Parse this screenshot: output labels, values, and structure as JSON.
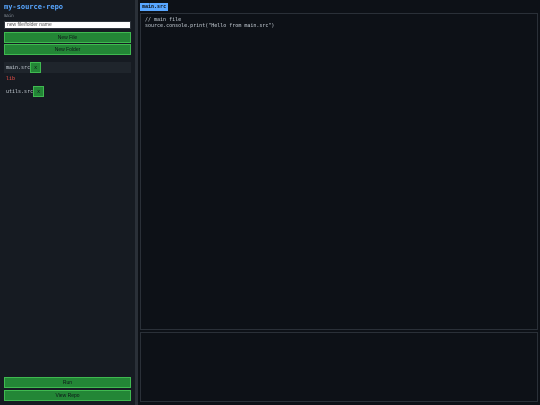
{
  "sidebar": {
    "repo_title": "my-source-repo",
    "branch": "main",
    "input_placeholder": "new file/folder name",
    "new_file_label": "New File",
    "new_folder_label": "New Folder",
    "files": [
      {
        "name": "main.src",
        "delete_label": "x"
      },
      {
        "name": "lib"
      },
      {
        "name": "utils.src",
        "delete_label": "x"
      }
    ],
    "run_label": "Run",
    "view_repo_label": "View Repo"
  },
  "editor": {
    "active_tab": "main.src",
    "lines": [
      "// main file",
      "source.console.print(\"Hello from main.src\")"
    ]
  },
  "colors": {
    "accent": "#58a6ff",
    "button": "#238636",
    "folder": "#f85149",
    "background": "#0d1117"
  }
}
